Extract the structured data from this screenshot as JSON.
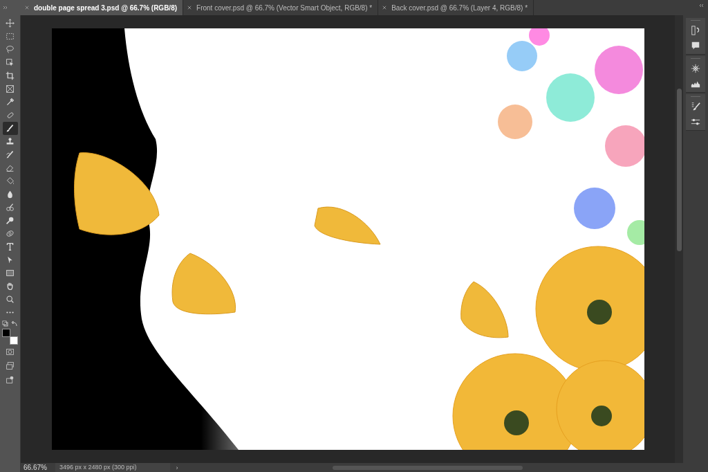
{
  "tabs": [
    {
      "label": "double page spread 3.psd @ 66.7% (RGB/8)",
      "selected": true
    },
    {
      "label": "Front cover.psd @ 66.7% (Vector Smart Object, RGB/8) *",
      "selected": false
    },
    {
      "label": "Back cover.psd @ 66.7% (Layer 4, RGB/8) *",
      "selected": false
    }
  ],
  "tools": [
    {
      "kind": "move",
      "selected": false
    },
    {
      "kind": "marquee",
      "selected": false
    },
    {
      "kind": "lasso",
      "selected": false
    },
    {
      "kind": "object-select",
      "selected": false
    },
    {
      "kind": "crop",
      "selected": false
    },
    {
      "kind": "frame",
      "selected": false
    },
    {
      "kind": "eyedropper",
      "selected": false
    },
    {
      "kind": "healing",
      "selected": false
    },
    {
      "kind": "brush",
      "selected": true
    },
    {
      "kind": "stamp",
      "selected": false
    },
    {
      "kind": "history-brush",
      "selected": false
    },
    {
      "kind": "eraser",
      "selected": false
    },
    {
      "kind": "bucket",
      "selected": false
    },
    {
      "kind": "blur",
      "selected": false
    },
    {
      "kind": "smudge",
      "selected": false
    },
    {
      "kind": "dodge",
      "selected": false
    },
    {
      "kind": "pen",
      "selected": false
    },
    {
      "kind": "type",
      "selected": false
    },
    {
      "kind": "path-select",
      "selected": false
    },
    {
      "kind": "rectangle",
      "selected": false
    },
    {
      "kind": "hand",
      "selected": false
    },
    {
      "kind": "zoom",
      "selected": false
    },
    {
      "kind": "more",
      "selected": false
    }
  ],
  "swatches": [
    {
      "kind": "foreground",
      "color": "#000000"
    },
    {
      "kind": "background",
      "color": "#ffffff"
    }
  ],
  "lower_tools": [
    {
      "kind": "quick-mask"
    },
    {
      "kind": "screen-mode"
    },
    {
      "kind": "edit-toolbar"
    }
  ],
  "panel_groups": [
    {
      "panels": [
        {
          "kind": "history"
        },
        {
          "kind": "comments"
        }
      ]
    },
    {
      "panels": [
        {
          "kind": "navigator"
        },
        {
          "kind": "histogram"
        }
      ]
    },
    {
      "panels": [
        {
          "kind": "brushes"
        },
        {
          "kind": "adjustments"
        }
      ]
    }
  ],
  "status_bar": {
    "zoom": "66.67%",
    "document_size": "3496 px x 2480 px (300 ppi)",
    "arrow": "›"
  }
}
